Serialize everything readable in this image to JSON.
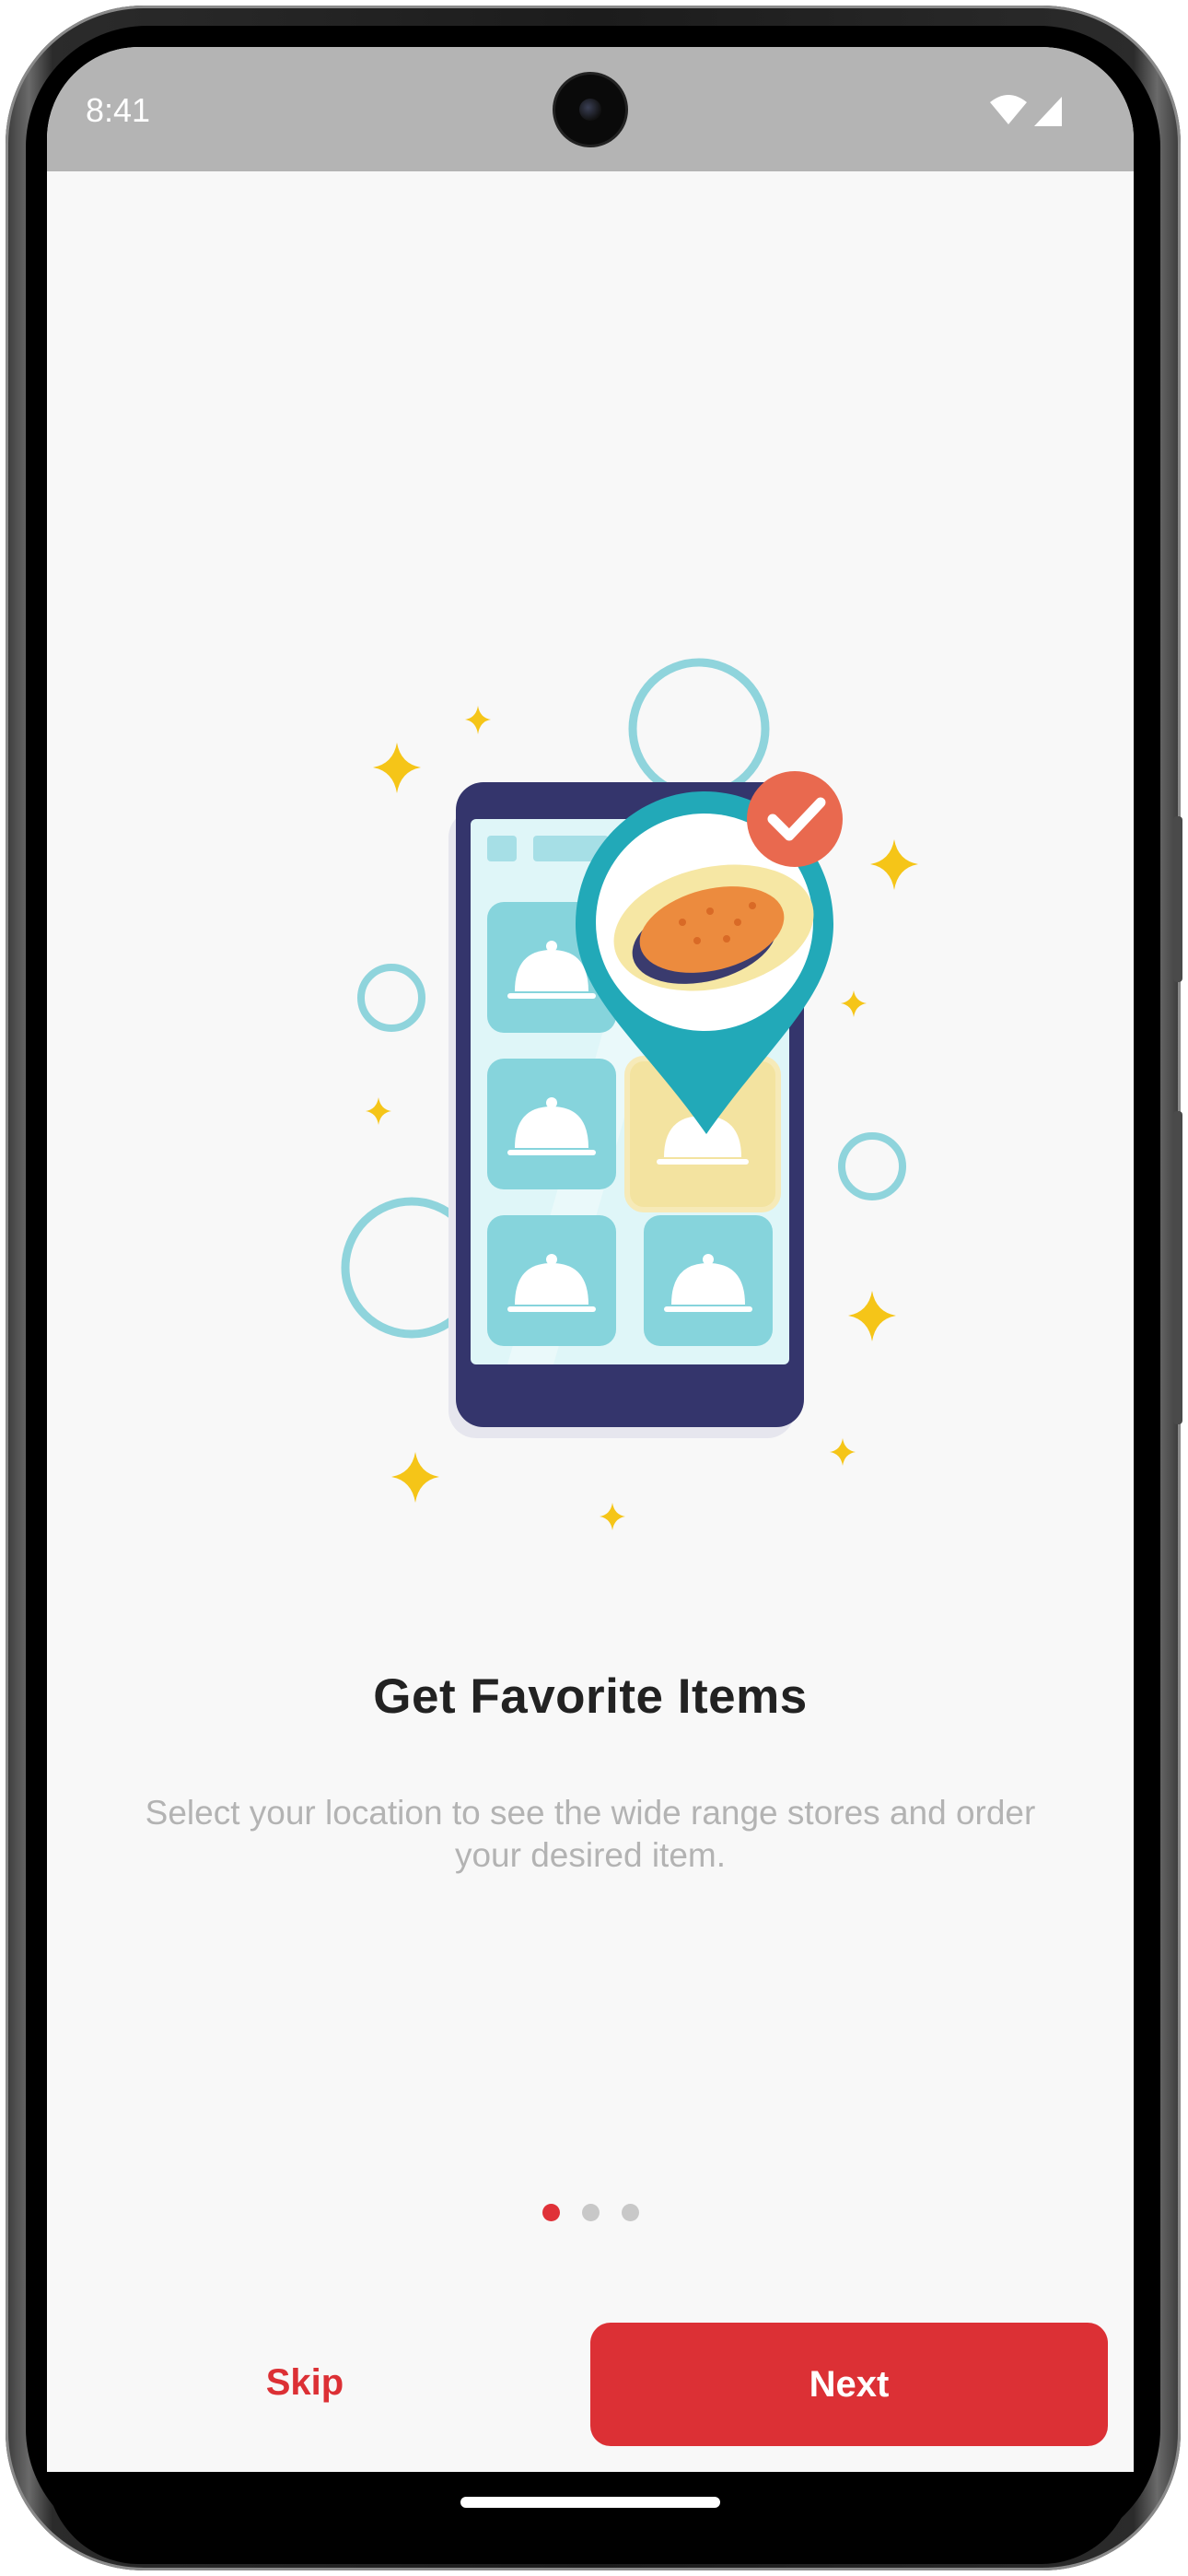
{
  "status_bar": {
    "time": "8:41",
    "icons": [
      "wifi-icon",
      "cellular-signal-icon"
    ]
  },
  "onboarding": {
    "illustration": "phone-food-order-illustration",
    "title": "Get Favorite Items",
    "description": "Select your location to see the wide range stores and order your desired item.",
    "pagination": {
      "total": 3,
      "current": 1
    }
  },
  "actions": {
    "skip_label": "Skip",
    "next_label": "Next"
  },
  "colors": {
    "accent": "#dc3035",
    "background": "#f8f8f8",
    "status_bar": "#b4b4b4"
  }
}
